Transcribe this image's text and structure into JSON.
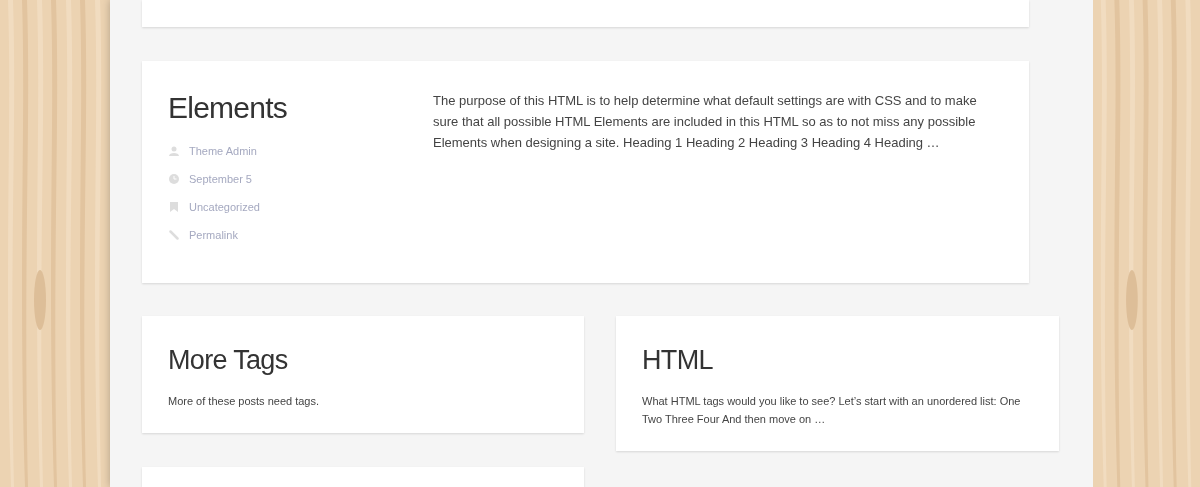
{
  "featured_post": {
    "title": "Elements",
    "meta": [
      {
        "kind": "author",
        "text": "Theme Admin"
      },
      {
        "kind": "date",
        "text": "September 5"
      },
      {
        "kind": "category",
        "text": "Uncategorized"
      },
      {
        "kind": "permalink",
        "text": "Permalink"
      }
    ],
    "excerpt": "The purpose of this HTML is to help determine what default settings are with CSS and to make sure that all possible HTML Elements are included in this HTML so as to not miss any possible Elements when designing a site. Heading 1 Heading 2 Heading 3 Heading 4 Heading …"
  },
  "posts": [
    {
      "title": "More Tags",
      "excerpt": "More of these posts need tags."
    },
    {
      "title": "HTML",
      "excerpt": "What HTML tags would you like to see? Let’s start with an unordered list: One Two Three Four And then move on …"
    }
  ]
}
